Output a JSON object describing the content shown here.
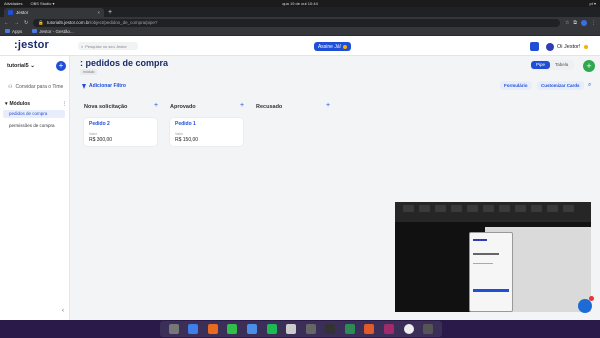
{
  "os": {
    "left": "Atividades",
    "app": "OBS Studio ▾",
    "clock": "qua 19 de out  10:44",
    "status": "pt ▾"
  },
  "browser": {
    "tab_title": "Jestor",
    "new_tab": "+",
    "url_host": "tutorial5.jestor.com.br",
    "url_path": "/object/pedidos_de_compra/pipe?",
    "bookmarks": [
      "Apps",
      "Jestor - Gestão..."
    ]
  },
  "app": {
    "logo": ":jestor",
    "search_placeholder": "Pesquise no seu Jestor",
    "assine_label": "Assine Já!",
    "user_label": "Oi Jestor!",
    "workspace": "tutorial5",
    "invite": "Convidar para o Time",
    "modules_header": "Módulos",
    "modules": [
      "pedidos de compra",
      "permissões de compra"
    ],
    "page_title": ": pedidos de compra",
    "page_tag": "módulo",
    "view_pipe": "Pipe",
    "view_table": "Tabela",
    "filter_label": "Adicionar Filtro",
    "formulario": "Formulário",
    "customizar": "Customizar Cards",
    "columns": [
      {
        "title": "Nova solicitação",
        "cards": [
          {
            "name": "Pedido 2",
            "label": "Valor",
            "value": "R$ 300,00"
          }
        ]
      },
      {
        "title": "Aprovado",
        "cards": [
          {
            "name": "Pedido 1",
            "label": "Valor",
            "value": "R$ 150,00"
          }
        ]
      },
      {
        "title": "Recusado",
        "cards": []
      }
    ]
  },
  "colors": {
    "accent": "#1f4fd6",
    "brand": "#1a2b6b",
    "fab": "#2fa84f"
  }
}
